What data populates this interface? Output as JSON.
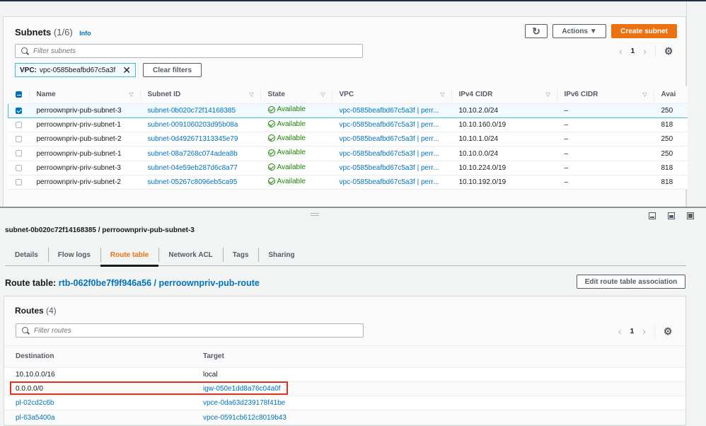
{
  "subnets": {
    "title": "Subnets",
    "count": "(1/6)",
    "info_label": "Info",
    "filter_placeholder": "Filter subnets",
    "filter_token": {
      "key": "VPC:",
      "value": "vpc-0585beafbd67c5a3f"
    },
    "clear_filters_label": "Clear filters",
    "actions_label": "Actions ▼",
    "create_label": "Create subnet",
    "refresh_icon": "refresh-icon",
    "page": "1",
    "columns": [
      "Name",
      "Subnet ID",
      "State",
      "VPC",
      "IPv4 CIDR",
      "IPv6 CIDR",
      "Avai"
    ],
    "rows": [
      {
        "selected": true,
        "name": "perroownpriv-pub-subnet-3",
        "subnet_id": "subnet-0b020c72f14168385",
        "state": "Available",
        "vpc": "vpc-0585beafbd67c5a3f | perr...",
        "ipv4": "10.10.2.0/24",
        "ipv6": "–",
        "avail": "250"
      },
      {
        "selected": false,
        "name": "perroownpriv-priv-subnet-1",
        "subnet_id": "subnet-0091060203d95b08a",
        "state": "Available",
        "vpc": "vpc-0585beafbd67c5a3f | perr...",
        "ipv4": "10.10.160.0/19",
        "ipv6": "–",
        "avail": "818"
      },
      {
        "selected": false,
        "name": "perroownpriv-pub-subnet-2",
        "subnet_id": "subnet-0d492671313345e79",
        "state": "Available",
        "vpc": "vpc-0585beafbd67c5a3f | perr...",
        "ipv4": "10.10.1.0/24",
        "ipv6": "–",
        "avail": "250"
      },
      {
        "selected": false,
        "name": "perroownpriv-pub-subnet-1",
        "subnet_id": "subnet-08a7268c074adea8b",
        "state": "Available",
        "vpc": "vpc-0585beafbd67c5a3f | perr...",
        "ipv4": "10.10.0.0/24",
        "ipv6": "–",
        "avail": "250"
      },
      {
        "selected": false,
        "name": "perroownpriv-priv-subnet-3",
        "subnet_id": "subnet-04e59eb287d6c8a77",
        "state": "Available",
        "vpc": "vpc-0585beafbd67c5a3f | perr...",
        "ipv4": "10.10.224.0/19",
        "ipv6": "–",
        "avail": "818"
      },
      {
        "selected": false,
        "name": "perroownpriv-priv-subnet-2",
        "subnet_id": "subnet-05267c8096eb5ca95",
        "state": "Available",
        "vpc": "vpc-0585beafbd67c5a3f | perr...",
        "ipv4": "10.10.192.0/19",
        "ipv6": "–",
        "avail": "818"
      }
    ]
  },
  "detail": {
    "title": "subnet-0b020c72f14168385 / perroownpriv-pub-subnet-3",
    "tabs": [
      {
        "label": "Details",
        "active": false
      },
      {
        "label": "Flow logs",
        "active": false
      },
      {
        "label": "Route table",
        "active": true
      },
      {
        "label": "Network ACL",
        "active": false
      },
      {
        "label": "Tags",
        "active": false
      },
      {
        "label": "Sharing",
        "active": false
      }
    ],
    "route_table_label": "Route table:",
    "route_table_link": "rtb-062f0be7f9f946a56 / perroownpriv-pub-route",
    "edit_association_label": "Edit route table association"
  },
  "routes": {
    "title": "Routes",
    "count": "(4)",
    "filter_placeholder": "Filter routes",
    "page": "1",
    "columns": [
      "Destination",
      "Target"
    ],
    "rows": [
      {
        "destination": "10.10.0.0/16",
        "destination_link": false,
        "target": "local",
        "target_link": false,
        "highlighted": false
      },
      {
        "destination": "0.0.0.0/0",
        "destination_link": false,
        "target": "igw-050e1dd8a76c04a0f",
        "target_link": true,
        "highlighted": true
      },
      {
        "destination": "pl-02cd2c6b",
        "destination_link": true,
        "target": "vpce-0da63d239178f41be",
        "target_link": true,
        "highlighted": false
      },
      {
        "destination": "pl-63a5400a",
        "destination_link": true,
        "target": "vpce-0591cb612c8019b43",
        "target_link": true,
        "highlighted": false
      }
    ]
  },
  "colors": {
    "primary_button": "#ec7211",
    "link": "#0073bb",
    "available": "#1d8102",
    "selection_border": "#44b9d6",
    "highlight_box": "#e0301e"
  }
}
